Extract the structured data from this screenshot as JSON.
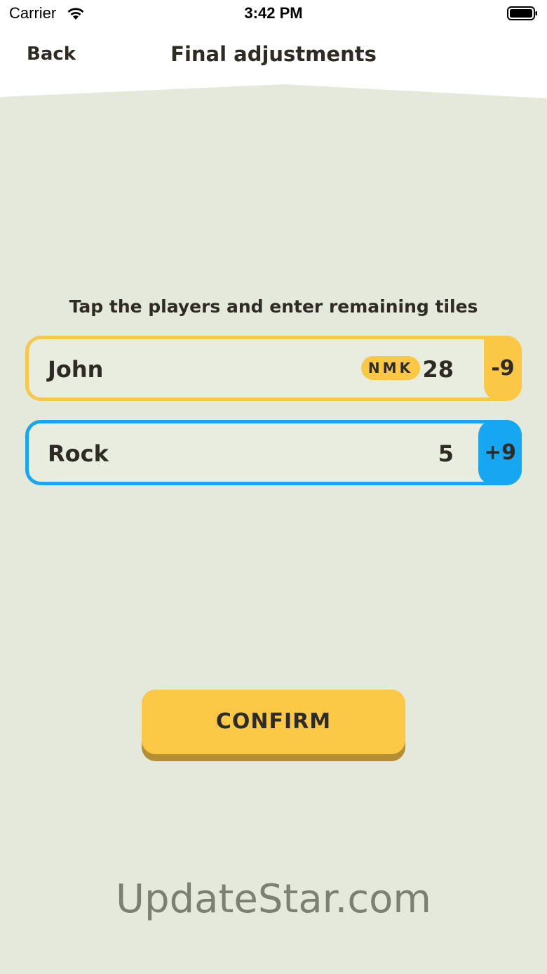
{
  "status_bar": {
    "carrier": "Carrier",
    "time": "3:42 PM",
    "wifi_icon": "wifi-icon",
    "battery_icon": "battery-full-icon"
  },
  "nav": {
    "back_label": "Back",
    "title": "Final adjustments"
  },
  "instructions": "Tap the players and enter remaining tiles",
  "players": [
    {
      "name": "John",
      "badge": "NMK",
      "tiles": "28",
      "delta": "-9",
      "color": "#f7c84c"
    },
    {
      "name": "Rock",
      "tiles": "5",
      "delta": "+9",
      "color": "#16a6f2"
    }
  ],
  "confirm_label": "CONFIRM",
  "watermark": "UpdateStar.com",
  "colors": {
    "background": "#e5e9dc",
    "accent_yellow": "#fcc947",
    "accent_blue": "#16a6f2",
    "text": "#2e2b25"
  }
}
